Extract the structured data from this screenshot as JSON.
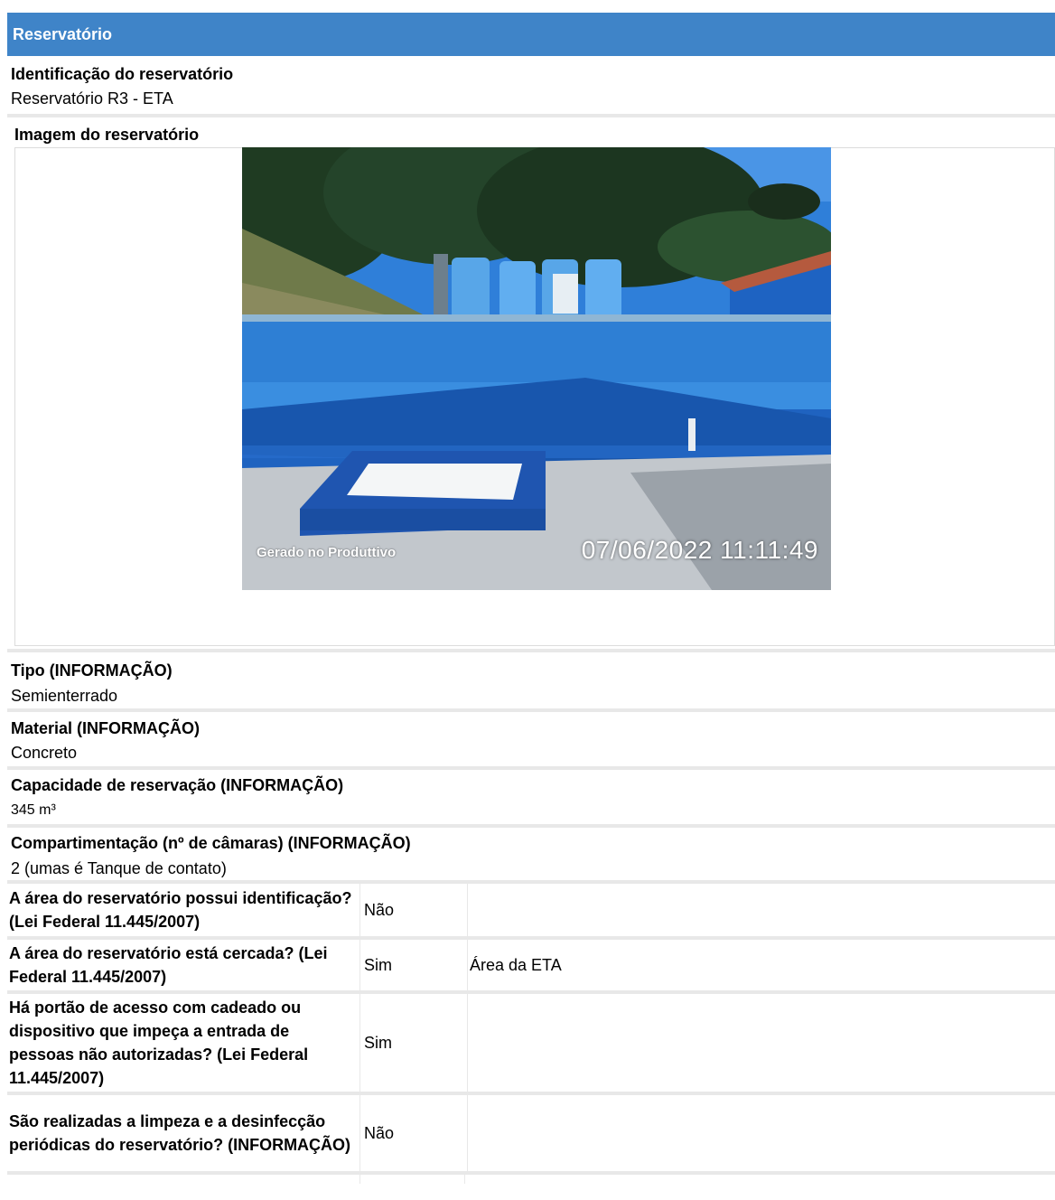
{
  "section": {
    "title": "Reservatório"
  },
  "fields": {
    "identificacao": {
      "label": "Identificação do reservatório",
      "value": "Reservatório R3 - ETA"
    },
    "imagem": {
      "label": "Imagem do reservatório",
      "watermark_left": "Gerado no Produttivo",
      "watermark_right": "07/06/2022 11:11:49"
    },
    "tipo": {
      "label": "Tipo (INFORMAÇÃO)",
      "value": "Semienterrado"
    },
    "material": {
      "label": "Material (INFORMAÇÃO)",
      "value": "Concreto"
    },
    "capacidade": {
      "label": "Capacidade de reservação (INFORMAÇÃO)",
      "value": "345 m³"
    },
    "compartimentacao": {
      "label": "Compartimentação (nº de câmaras) (INFORMAÇÃO)",
      "value": "2 (umas é Tanque de contato)"
    }
  },
  "questions": [
    {
      "question": "A área do reservatório possui identificação? (Lei Federal 11.445/2007)",
      "answer": "Não",
      "comment": ""
    },
    {
      "question": "A área do reservatório está cercada? (Lei Federal 11.445/2007)",
      "answer": "Sim",
      "comment": "Área da ETA"
    },
    {
      "question": "Há portão de acesso com cadeado ou dispositivo que impeça a entrada de pessoas não autorizadas? (Lei Federal 11.445/2007)",
      "answer": "Sim",
      "comment": ""
    },
    {
      "question": "São realizadas a limpeza e a desinfecção periódicas do reservatório? (INFORMAÇÃO)",
      "answer": "Não",
      "comment": ""
    }
  ],
  "colors": {
    "header_bg": "#3f84c8",
    "separator": "#e8e8e8"
  }
}
